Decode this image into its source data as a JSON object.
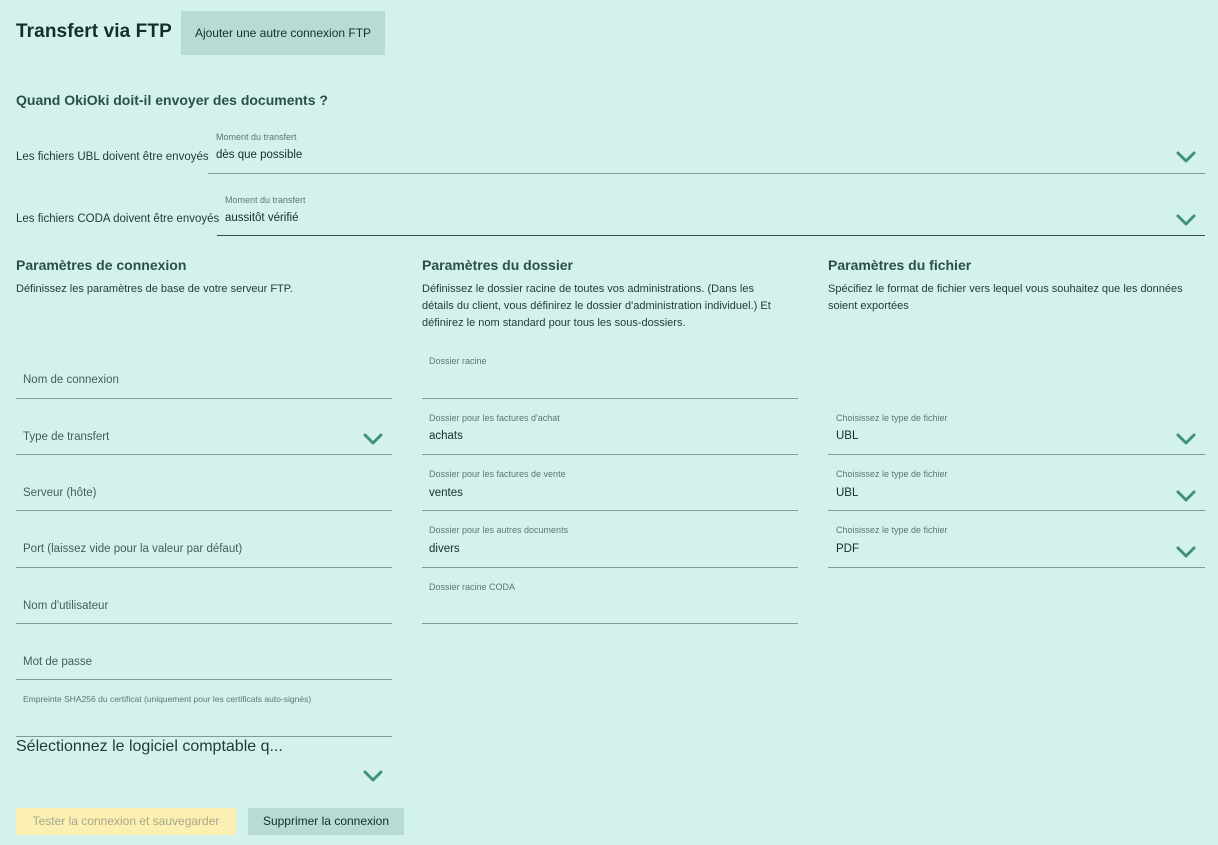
{
  "header": {
    "title": "Transfert via FTP",
    "add_connection_label": "Ajouter une autre connexion FTP"
  },
  "schedule": {
    "question": "Quand OkiOki doit-il envoyer des documents ?",
    "ubl": {
      "row_label": "Les fichiers UBL doivent être envoyés",
      "field_label": "Moment du transfert",
      "value": "dès que possible"
    },
    "coda": {
      "row_label": "Les fichiers CODA doivent être envoyés",
      "field_label": "Moment du transfert",
      "value": "aussitôt vérifié"
    }
  },
  "connection": {
    "title": "Paramètres de connexion",
    "description": "Définissez les paramètres de base de votre serveur FTP.",
    "connection_name_placeholder": "Nom de connexion",
    "transfer_type_placeholder": "Type de transfert",
    "server_placeholder": "Serveur (hôte)",
    "port_placeholder": "Port (laissez vide pour la valeur par défaut)",
    "username_placeholder": "Nom d'utilisateur",
    "password_placeholder": "Mot de passe",
    "fingerprint_label": "Empreinte SHA256 du certificat (uniquement pour les certificats auto-signés)",
    "software_placeholder": "Sélectionnez le logiciel comptable q..."
  },
  "folder": {
    "title": "Paramètres du dossier",
    "description_line1": "Définissez le dossier racine de toutes vos administrations. (Dans les",
    "description_line2": "détails du client, vous définirez le dossier d'administration individuel.) Et",
    "description_line3": "définirez le nom standard pour tous les sous-dossiers.",
    "root_label": "Dossier racine",
    "root_value": "",
    "purchase_label": "Dossier pour les factures d'achat",
    "purchase_value": "achats",
    "sales_label": "Dossier pour les factures de vente",
    "sales_value": "ventes",
    "other_label": "Dossier pour les autres documents",
    "other_value": "divers",
    "coda_root_label": "Dossier racine CODA",
    "coda_root_value": ""
  },
  "file": {
    "title": "Paramètres du fichier",
    "description_line1": "Spécifiez le format de fichier vers lequel vous souhaitez que les données",
    "description_line2": "soient exportées",
    "type_label": "Choisissez le type de fichier",
    "purchase_type": "UBL",
    "sales_type": "UBL",
    "other_type": "PDF"
  },
  "actions": {
    "test_save_label": "Tester la connexion et sauvegarder",
    "delete_label": "Supprimer la connexion"
  },
  "colors": {
    "background": "#d4f2ec",
    "secondary_button": "#b8dcd5",
    "disabled_primary_button": "#fbf0b2",
    "chevron": "#3f8f82"
  }
}
